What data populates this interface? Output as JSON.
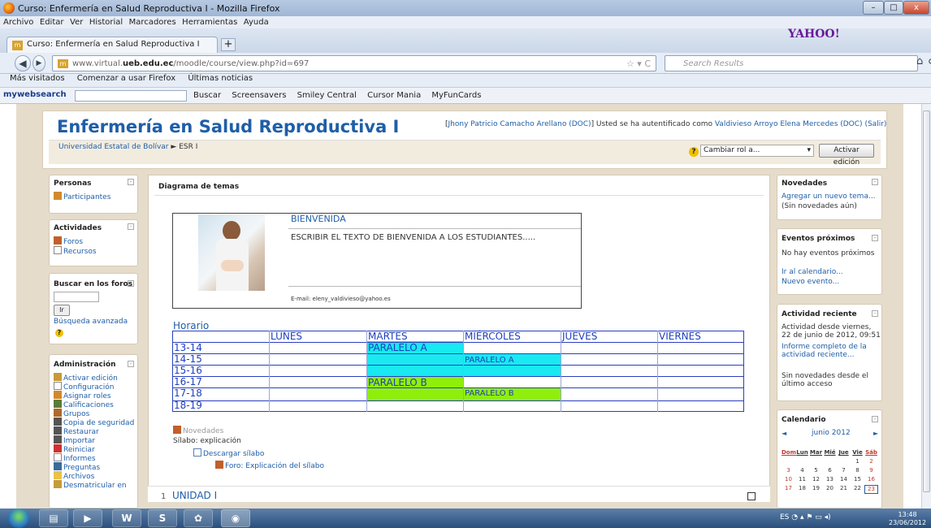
{
  "window": {
    "title": "Curso: Enfermería en Salud Reproductiva I - Mozilla Firefox",
    "minimize": "–",
    "maximize": "□",
    "close": "x"
  },
  "menu": [
    "Archivo",
    "Editar",
    "Ver",
    "Historial",
    "Marcadores",
    "Herramientas",
    "Ayuda"
  ],
  "tab": {
    "label": "Curso: Enfermería en Salud Reproductiva I",
    "new_tab": "+"
  },
  "yahoo": "YAHOO!",
  "address": {
    "host": "www.virtual.",
    "domain": "ueb.edu.ec",
    "path": "/moodle/course/view.php?id=697"
  },
  "search": {
    "placeholder": "Search Results"
  },
  "bookmarks": [
    "Más visitados",
    "Comenzar a usar Firefox",
    "Últimas noticias"
  ],
  "toolbar": {
    "brand": "mywebsearch",
    "items": [
      "Buscar",
      "Screensavers",
      "Smiley Central",
      "Cursor Mania",
      "MyFunCards"
    ]
  },
  "course": {
    "title": "Enfermería en Salud Reproductiva I",
    "user_prefix": "[",
    "user_name": "Jhony Patricio Camacho Arellano (DOC)",
    "auth_text": "] Usted se ha autentificado como ",
    "auth_name": "Valdivieso Arroyo Elena Mercedes (DOC)",
    "logout": "(Salir)",
    "breadcrumb_home": "Universidad Estatal de Bolívar",
    "breadcrumb_sep": "►",
    "breadcrumb_current": "ESR I",
    "role_select": "Cambiar rol a...",
    "edit_button": "Activar edición"
  },
  "left": {
    "personas": {
      "title": "Personas",
      "items": [
        "Participantes"
      ]
    },
    "actividades": {
      "title": "Actividades",
      "items": [
        "Foros",
        "Recursos"
      ]
    },
    "buscar": {
      "title": "Buscar en los foros",
      "button": "Ir",
      "advanced": "Búsqueda avanzada"
    },
    "admin": {
      "title": "Administración",
      "items": [
        "Activar edición",
        "Configuración",
        "Asignar roles",
        "Calificaciones",
        "Grupos",
        "Copia de seguridad",
        "Restaurar",
        "Importar",
        "Reiniciar",
        "Informes",
        "Preguntas",
        "Archivos",
        "Desmatricular en"
      ]
    }
  },
  "main": {
    "heading": "Diagrama de temas",
    "welcome_title": "BIENVENIDA",
    "welcome_text": "ESCRIBIR EL TEXTO DE BIENVENIDA A LOS ESTUDIANTES.....",
    "email": "E-mail: eleny_valdivieso@yahoo.es",
    "horario": "Horario",
    "days": [
      "LUNES",
      "MARTES",
      "MIÉRCOLES",
      "JUEVES",
      "VIERNES"
    ],
    "hours": [
      "13-14",
      "14-15",
      "15-16",
      "16-17",
      "17-18",
      "18-19"
    ],
    "paralelo_a": "PARALELO A",
    "paralelo_b": "PARALELO B",
    "novedades": "Novedades",
    "silabo": "Sílabo: explicación",
    "descargar": "Descargar sílabo",
    "foro_silabo": "Foro: Explicación del sílabo",
    "section_num": "1",
    "section_title": "UNIDAD I"
  },
  "right": {
    "novedades": {
      "title": "Novedades",
      "link": "Agregar un nuevo tema...",
      "note": "(Sin novedades aún)"
    },
    "eventos": {
      "title": "Eventos próximos",
      "note": "No hay eventos próximos",
      "links": [
        "Ir al calendario...",
        "Nuevo evento..."
      ]
    },
    "actividad": {
      "title": "Actividad reciente",
      "since": "Actividad desde viernes, 22 de junio de 2012, 09:51",
      "link": "Informe completo de la actividad reciente...",
      "note": "Sin novedades desde el último acceso"
    },
    "calendario": {
      "title": "Calendario",
      "month": "junio 2012",
      "prev": "◄",
      "next": "►",
      "weekdays": [
        "Dom",
        "Lun",
        "Mar",
        "Mié",
        "Jue",
        "Vie",
        "Sáb"
      ],
      "weeks": [
        [
          "",
          "",
          "",
          "",
          "",
          "1",
          "2"
        ],
        [
          "3",
          "4",
          "5",
          "6",
          "7",
          "8",
          "9"
        ],
        [
          "10",
          "11",
          "12",
          "13",
          "14",
          "15",
          "16"
        ],
        [
          "17",
          "18",
          "19",
          "20",
          "21",
          "22",
          "23"
        ]
      ]
    }
  },
  "taskbar": {
    "lang": "ES",
    "time": "13:48",
    "date": "23/06/2012"
  },
  "colors": {
    "link": "#1f5ea8",
    "cyan": "#19e9f0",
    "lime": "#8fef0b",
    "schedule_border": "#2a3fbf",
    "page_bg": "#e6dccb"
  }
}
